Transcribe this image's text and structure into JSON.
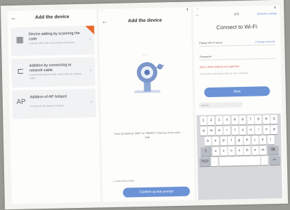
{
  "panel1": {
    "back": "←",
    "title": "Add the device",
    "cards": [
      {
        "icon": "qr-code-icon",
        "glyph": "▦",
        "title": "Device adding by scanning the code",
        "desc": "Scan the QR code on the device or the box"
      },
      {
        "icon": "network-cable-icon",
        "glyph": "⊏",
        "title": "Addition by connecting to network cable",
        "desc": "Connect the device to the router with the network cable"
      },
      {
        "icon": "ap-hotspot-icon",
        "glyph": "AP",
        "title": "Addition of AP hotspot",
        "desc": "Connect to the device's hotspot"
      }
    ],
    "chevron": "›"
  },
  "panel2": {
    "back": "←",
    "title": "Add the device",
    "step_text": "Hear prompting \"WiFi\" or \"READY\" then go to the next step",
    "checkbox_label": "I heard the prompt",
    "button": "Confirm as the prompt"
  },
  "panel3": {
    "back": "←",
    "step": "1/3",
    "top_right": "Network settings",
    "title": "Connect to Wi-Fi",
    "ssid_label": "Please Wi-Fi name",
    "ssid_link": "Change network",
    "password_label": "Password",
    "hint_red": "Only 2.4GHz networks are supported",
    "hint": "Characters and passwords are case sensitive",
    "next_button": "Next",
    "search_placeholder": "Search",
    "keyboard": {
      "row1": [
        "1",
        "2",
        "3",
        "4",
        "5",
        "6",
        "7",
        "8",
        "9",
        "0"
      ],
      "row2": [
        "q",
        "w",
        "e",
        "r",
        "t",
        "y",
        "u",
        "i",
        "o",
        "p"
      ],
      "row3": [
        "a",
        "s",
        "d",
        "f",
        "g",
        "h",
        "j",
        "k",
        "l"
      ],
      "row4": [
        "⇧",
        "z",
        "x",
        "c",
        "v",
        "b",
        "n",
        "m",
        "⌫"
      ],
      "row5": [
        "?123",
        ",",
        "space",
        ".",
        "↵"
      ]
    }
  },
  "colors": {
    "accent": "#6b93d6",
    "corner": "#e8682a"
  }
}
